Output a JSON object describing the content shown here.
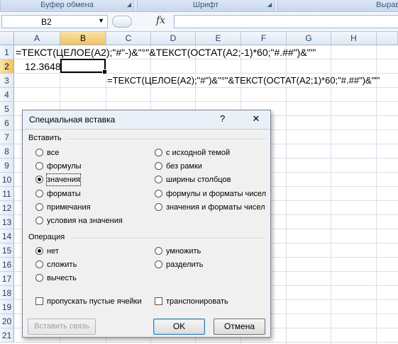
{
  "ribbon": {
    "groups": [
      "Буфер обмена",
      "Шрифт",
      "Выравни"
    ]
  },
  "formula_bar": {
    "name_box": "B2",
    "fx": "fx",
    "formula": ""
  },
  "sheet": {
    "columns": [
      "A",
      "B",
      "C",
      "D",
      "E",
      "F",
      "G",
      "H"
    ],
    "selected_column": "B",
    "rows": [
      "1",
      "2",
      "3",
      "4",
      "5",
      "6",
      "7",
      "8",
      "9",
      "10",
      "11",
      "12",
      "13",
      "14",
      "15",
      "16",
      "17",
      "18",
      "19",
      "20",
      "21"
    ],
    "selected_row": "2",
    "a1": "=ТЕКСТ(ЦЕЛОЕ(A2);\"#\"-)&\"°\"&ТЕКСТ(ОСТАТ(A2;-1)*60;\"#.##\")&\"'\"",
    "a2": "12.3648",
    "c3": "=ТЕКСТ(ЦЕЛОЕ(A2);\"#\")&\"°\"&ТЕКСТ(ОСТАТ(A2;1)*60;\"#.##\")&\"'\""
  },
  "dialog": {
    "title": "Специальная вставка",
    "help": "?",
    "close": "✕",
    "paste_section": "Вставить",
    "paste_left": [
      "все",
      "формулы",
      "значения",
      "форматы",
      "примечания",
      "условия на значения"
    ],
    "paste_right": [
      "с исходной темой",
      "без рамки",
      "ширины столбцов",
      "формулы и форматы чисел",
      "значения и форматы чисел"
    ],
    "paste_selected": "значения",
    "operation_section": "Операция",
    "op_left": [
      "нет",
      "сложить",
      "вычесть"
    ],
    "op_right": [
      "умножить",
      "разделить"
    ],
    "op_selected": "нет",
    "skip_blanks": "пропускать пустые ячейки",
    "transpose": "транспонировать",
    "paste_link": "Вставить связь",
    "ok": "OK",
    "cancel": "Отмена"
  }
}
